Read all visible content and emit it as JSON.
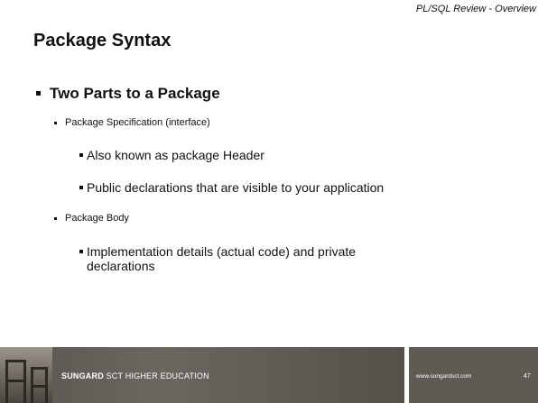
{
  "header": {
    "text": "PL/SQL  Review - Overview"
  },
  "title": "Package Syntax",
  "bullets": {
    "b1": "Two Parts to a Package",
    "b1_1": "Package Specification (interface)",
    "b1_1_1": "Also known as package Header",
    "b1_1_2": "Public declarations that are visible to your application",
    "b1_2": "Package Body",
    "b1_2_1": "Implementation details (actual code) and  private declarations"
  },
  "footer": {
    "brand_strong": "SUNGARD",
    "brand_rest": " SCT HIGHER EDUCATION",
    "website": "www.sungardsct.com",
    "page_number": "47"
  }
}
